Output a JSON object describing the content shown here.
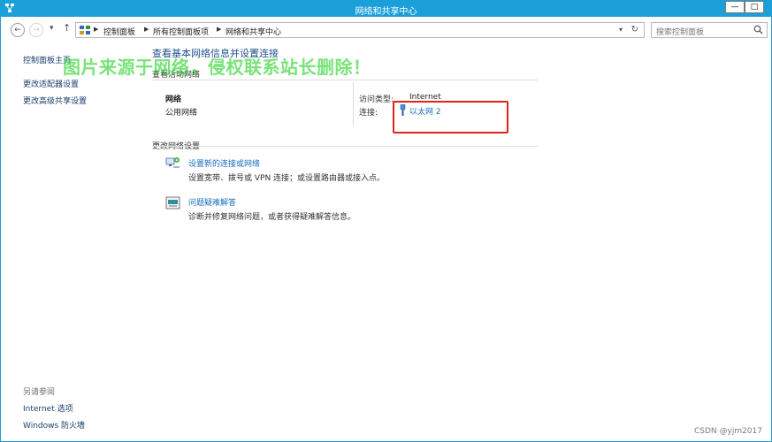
{
  "window": {
    "title": "网络和共享中心",
    "minimize_glyph": "—",
    "maximize_glyph": "□"
  },
  "address_bar": {
    "breadcrumbs": [
      "控制面板",
      "所有控制面板项",
      "网络和共享中心"
    ],
    "search_placeholder": "搜索控制面板"
  },
  "sidebar": {
    "items": [
      {
        "label": "控制面板主页"
      },
      {
        "label": "更改适配器设置"
      },
      {
        "label": "更改高级共享设置"
      }
    ],
    "see_also_heading": "另请参阅",
    "see_also": [
      {
        "label": "Internet 选项"
      },
      {
        "label": "Windows 防火墙"
      }
    ]
  },
  "main": {
    "heading": "查看基本网络信息并设置连接",
    "active_networks_heading": "查看活动网络",
    "network": {
      "name": "网络",
      "type": "公用网络",
      "access_type_label": "访问类型:",
      "access_type_value": "Internet",
      "connections_label": "连接:",
      "connection_name": "以太网 2"
    },
    "change_settings_heading": "更改网络设置",
    "tasks": [
      {
        "title": "设置新的连接或网络",
        "description": "设置宽带、拨号或 VPN 连接；或设置路由器或接入点。",
        "icon": "network-setup-icon"
      },
      {
        "title": "问题疑难解答",
        "description": "诊断并修复网络问题，或者获得疑难解答信息。",
        "icon": "troubleshoot-icon"
      }
    ]
  },
  "overlay": {
    "watermark": "图片来源于网络，侵权联系站长删除！",
    "credit": "CSDN @yjm2017",
    "highlight_color": "#d8261c"
  },
  "colors": {
    "titlebar": "#1a9fd8",
    "link": "#1a6cbf",
    "heading": "#1e4f8c"
  }
}
